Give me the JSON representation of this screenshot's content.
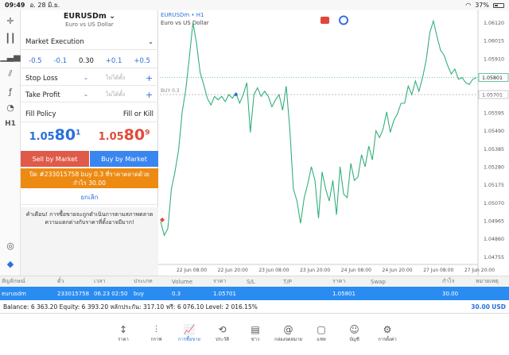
{
  "status_bar": {
    "time": "09:49",
    "date": "อ. 28 มิ.ย.",
    "battery": "37%"
  },
  "symbol": {
    "name": "EURUSDm",
    "description": "Euro vs US Dollar"
  },
  "order_type": "Market Execution",
  "volume": {
    "minus_large": "-0.5",
    "minus_small": "-0.1",
    "value": "0.30",
    "plus_small": "+0.1",
    "plus_large": "+0.5"
  },
  "stop_loss": {
    "label": "Stop Loss",
    "minus": "-",
    "placeholder": "ไม่ได้ตั้ง",
    "plus": "+"
  },
  "take_profit": {
    "label": "Take Profit",
    "minus": "-",
    "placeholder": "ไม่ได้ตั้ง",
    "plus": "+"
  },
  "fill_policy": {
    "label": "Fill Policy",
    "value": "Fill or Kill"
  },
  "quotes": {
    "sell": {
      "main": "1.05",
      "big": "80",
      "sup": "1"
    },
    "buy": {
      "main": "1.05",
      "big": "80",
      "sup": "9"
    }
  },
  "buttons": {
    "sell": "Sell by Market",
    "buy": "Buy by Market",
    "cancel": "ยกเลิก"
  },
  "close_notice": {
    "line1": "ปิด #233015758 buy 0.3 ที่ราคาตลาดด้วย",
    "line2": "กำไร 30.00"
  },
  "warning": "คำเตือน! การซื้อขายจะถูกดำเนินการตามสภาพตลาด ความแตกต่างกับราคาที่ตั้งอาจมีมาก!",
  "chart": {
    "symbol_tf": "EURUSDm • H1",
    "desc": "Euro vs US Dollar",
    "buy_label": "BUY 0.3",
    "bid_tag": "1.05801",
    "entry_tag": "1.05701",
    "colors": {
      "line": "#33b07a",
      "bid": "#2bb06c",
      "entry": "#999999"
    }
  },
  "chart_data": {
    "type": "line",
    "series": [
      {
        "values": [
          1.0496,
          1.0488,
          1.0492,
          1.0515,
          1.0525,
          1.0538,
          1.056,
          1.0573,
          1.0592,
          1.0612,
          1.06,
          1.0583,
          1.0576,
          1.0568,
          1.0564,
          1.0569,
          1.0567,
          1.0569,
          1.0566,
          1.057,
          1.0568,
          1.0571,
          1.0565,
          1.057,
          1.0577,
          1.0548,
          1.057,
          1.0574,
          1.0569,
          1.0572,
          1.0569,
          1.0563,
          1.0567,
          1.057,
          1.0561,
          1.0575,
          1.055,
          1.0515,
          1.0508,
          1.0495,
          1.051,
          1.0518,
          1.0528,
          1.052,
          1.0498,
          1.0525,
          1.0515,
          1.0508,
          1.052,
          1.05,
          1.0528,
          1.0512,
          1.051,
          1.053,
          1.052,
          1.0522,
          1.0535,
          1.0528,
          1.054,
          1.0532,
          1.0549,
          1.0545,
          1.055,
          1.056,
          1.0548,
          1.0555,
          1.0559,
          1.0565,
          1.0565,
          1.0575,
          1.057,
          1.0578,
          1.0572,
          1.058,
          1.059,
          1.0606,
          1.0613,
          1.0604,
          1.0596,
          1.0593,
          1.0587,
          1.0582,
          1.0585,
          1.0579,
          1.058,
          1.0577,
          1.0576,
          1.0579,
          1.058
        ]
      }
    ],
    "x_labels": [
      "22 Jun 08:00",
      "22 Jun 20:00",
      "23 Jun 08:00",
      "23 Jun 20:00",
      "24 Jun 08:00",
      "24 Jun 20:00",
      "27 Jun 08:00",
      "27 Jun 20:00"
    ],
    "y_ticks": [
      "1.06120",
      "1.06015",
      "1.05910",
      "1.05801",
      "1.05701",
      "1.05595",
      "1.05490",
      "1.05385",
      "1.05280",
      "1.05175",
      "1.05070",
      "1.04965",
      "1.04860",
      "1.04755"
    ],
    "ylim": [
      1.0471,
      1.06155
    ],
    "bid": 1.05801,
    "entry": 1.05701
  },
  "positions": {
    "headers": [
      "สัญลักษณ์",
      "ตั๋ว",
      "เวลา",
      "ประเภท",
      "Volume",
      "ราคา",
      "S/L",
      "T/P",
      "ราคา",
      "Swap",
      "กำไร",
      "หมายเหตุ"
    ],
    "row": [
      "eurusdm",
      "233015758",
      "06.23 02:50",
      "buy",
      "0.3",
      "1.05701",
      "",
      "",
      "1.05801",
      "",
      "30.00",
      ""
    ]
  },
  "balance": {
    "text": "Balance: 6 363.20 Equity: 6 393.20 หลักประกัน: 317.10 ฟรี: 6 076.10 Level: 2 016.15%",
    "profit": "30.00",
    "currency": "USD"
  },
  "nav": [
    {
      "label": "ราคา",
      "icon": "↕"
    },
    {
      "label": "กราฟ",
      "icon": "⫶"
    },
    {
      "label": "การซื้อขาย",
      "icon": "📈",
      "active": true
    },
    {
      "label": "ประวัติ",
      "icon": "⟲"
    },
    {
      "label": "ข่าว",
      "icon": "▤"
    },
    {
      "label": "กล่องจดหมาย",
      "icon": "@"
    },
    {
      "label": "แชท",
      "icon": "▢"
    },
    {
      "label": "บัญชี",
      "icon": "☺"
    },
    {
      "label": "การตั้งค่า",
      "icon": "⚙"
    }
  ]
}
